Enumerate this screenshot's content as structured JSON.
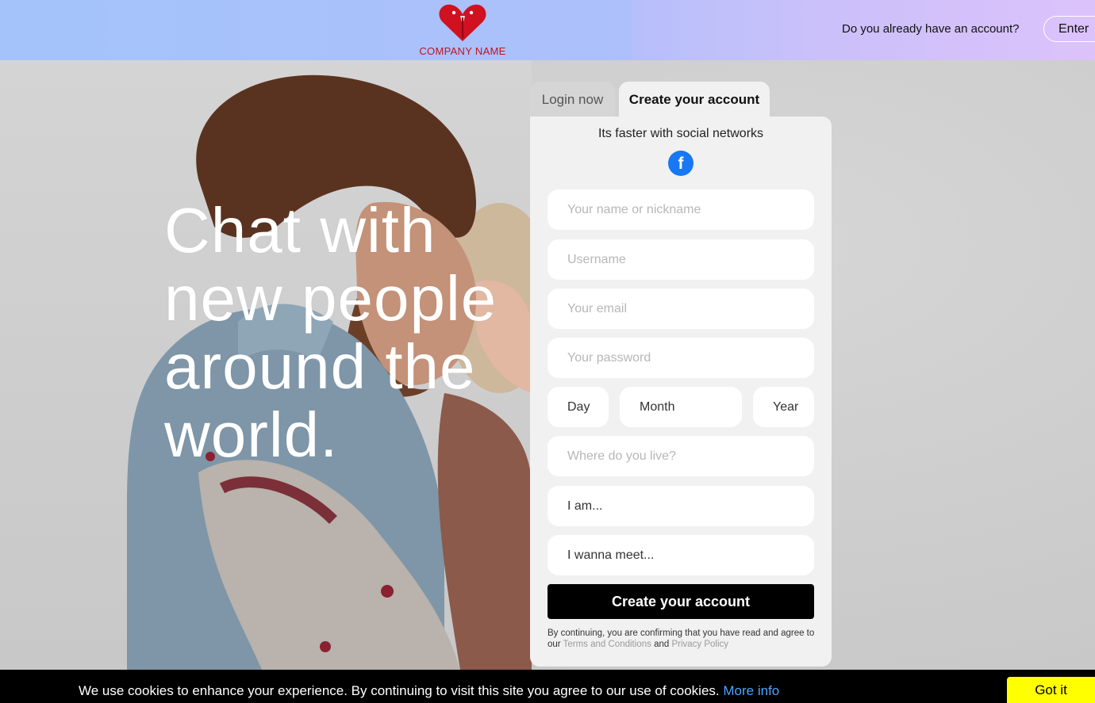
{
  "header": {
    "company_name": "COMPANY NAME",
    "have_account_text": "Do you already have an account?",
    "enter_label": "Enter"
  },
  "hero": {
    "title": "Chat with new people around the world."
  },
  "tabs": {
    "login": "Login now",
    "create": "Create your account"
  },
  "form": {
    "social_text": "Its faster with social networks",
    "facebook_glyph": "f",
    "name_placeholder": "Your name or nickname",
    "username_placeholder": "Username",
    "email_placeholder": "Your email",
    "password_placeholder": "Your password",
    "day_label": "Day",
    "month_label": "Month",
    "year_label": "Year",
    "location_placeholder": "Where do you live?",
    "i_am_label": "I am...",
    "wanna_meet_label": "I wanna meet...",
    "submit_label": "Create your account",
    "legal_prefix": "By continuing, you are confirming that you have read and agree to our",
    "terms_link": "Terms and Conditions",
    "legal_and": "and",
    "privacy_link": "Privacy Policy"
  },
  "cookie": {
    "text": "We use cookies to enhance your experience. By continuing to visit this site you agree to our use of cookies.",
    "more_info": "More info",
    "got_it": "Got it"
  },
  "colors": {
    "brand_red": "#c1121f",
    "facebook_blue": "#1877f2",
    "cookie_button": "#ffff00"
  }
}
